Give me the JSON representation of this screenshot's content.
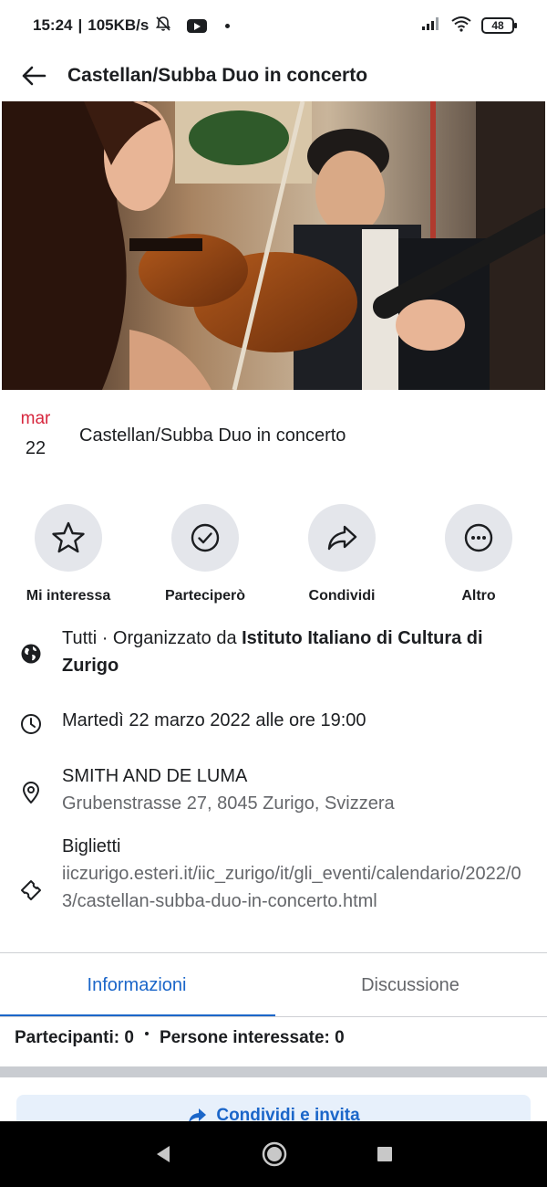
{
  "status": {
    "time": "15:24",
    "speed": "105KB/s",
    "battery": "48"
  },
  "header": {
    "title": "Castellan/Subba Duo in concerto"
  },
  "event": {
    "month": "mar",
    "day": "22",
    "title": "Castellan/Subba Duo in concerto"
  },
  "actions": [
    {
      "label": "Mi interessa",
      "icon": "star-icon"
    },
    {
      "label": "Parteciperò",
      "icon": "check-circle-icon"
    },
    {
      "label": "Condividi",
      "icon": "share-arrow-icon"
    },
    {
      "label": "Altro",
      "icon": "more-dots-icon"
    }
  ],
  "info": {
    "audience_prefix": "Tutti · Organizzato da ",
    "organizer": "Istituto Italiano di Cultura di Zurigo",
    "datetime": "Martedì 22 marzo 2022 alle ore 19:00",
    "venue": "SMITH AND DE LUMA",
    "address": "Grubenstrasse 27, 8045 Zurigo, Svizzera",
    "tickets_label": "Biglietti",
    "tickets_url": "iiczurigo.esteri.it/iic_zurigo/it/gli_eventi/calendario/2022/03/castellan-subba-duo-in-concerto.html"
  },
  "tabs": [
    {
      "label": "Informazioni",
      "active": true
    },
    {
      "label": "Discussione",
      "active": false
    }
  ],
  "stats": {
    "participants": "Partecipanti: 0",
    "interested": "Persone interessate: 0"
  },
  "cta": {
    "share_invite": "Condividi e invita"
  },
  "colors": {
    "accent": "#1b66c9",
    "date_red": "#d7263d",
    "button_bg": "#e4e6eb"
  }
}
